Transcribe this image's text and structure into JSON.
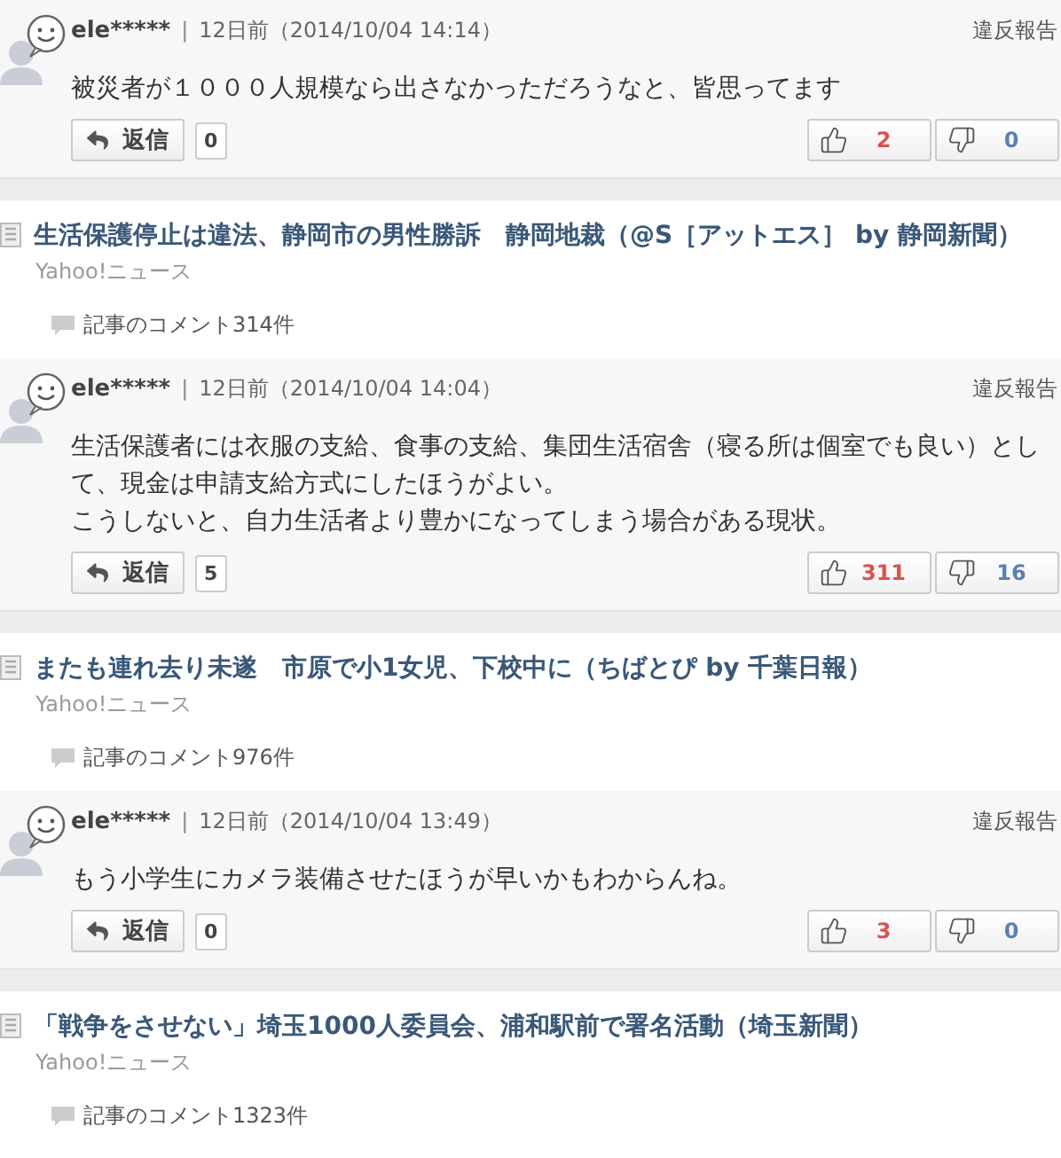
{
  "items": [
    {
      "kind": "comment",
      "user": "ele*****",
      "divider": "|",
      "time": "12日前（2014/10/04 14:14）",
      "report": "違反報告",
      "body": [
        "被災者が１０００人規模なら出さなかっただろうなと、皆思ってます"
      ],
      "reply": "返信",
      "reply_count": "0",
      "likes": "2",
      "dislikes": "0"
    },
    {
      "kind": "article",
      "title": "生活保護停止は違法、静岡市の男性勝訴　静岡地裁（@S［アットエス］ by 静岡新聞）",
      "source": "Yahoo!ニュース",
      "comments": "記事のコメント314件"
    },
    {
      "kind": "comment",
      "user": "ele*****",
      "divider": "|",
      "time": "12日前（2014/10/04 14:04）",
      "report": "違反報告",
      "body": [
        "生活保護者には衣服の支給、食事の支給、集団生活宿舎（寝る所は個室でも良い）として、現金は申請支給方式にしたほうがよい。",
        "こうしないと、自力生活者より豊かになってしまう場合がある現状。"
      ],
      "reply": "返信",
      "reply_count": "5",
      "likes": "311",
      "dislikes": "16"
    },
    {
      "kind": "article",
      "title": "またも連れ去り未遂　市原で小1女児、下校中に（ちばとぴ by 千葉日報）",
      "source": "Yahoo!ニュース",
      "comments": "記事のコメント976件"
    },
    {
      "kind": "comment",
      "user": "ele*****",
      "divider": "|",
      "time": "12日前（2014/10/04 13:49）",
      "report": "違反報告",
      "body": [
        "もう小学生にカメラ装備させたほうが早いかもわからんね。"
      ],
      "reply": "返信",
      "reply_count": "0",
      "likes": "3",
      "dislikes": "0"
    },
    {
      "kind": "article",
      "title": "「戦争をさせない」埼玉1000人委員会、浦和駅前で署名活動（埼玉新聞）",
      "source": "Yahoo!ニュース",
      "comments": "記事のコメント1323件"
    }
  ]
}
